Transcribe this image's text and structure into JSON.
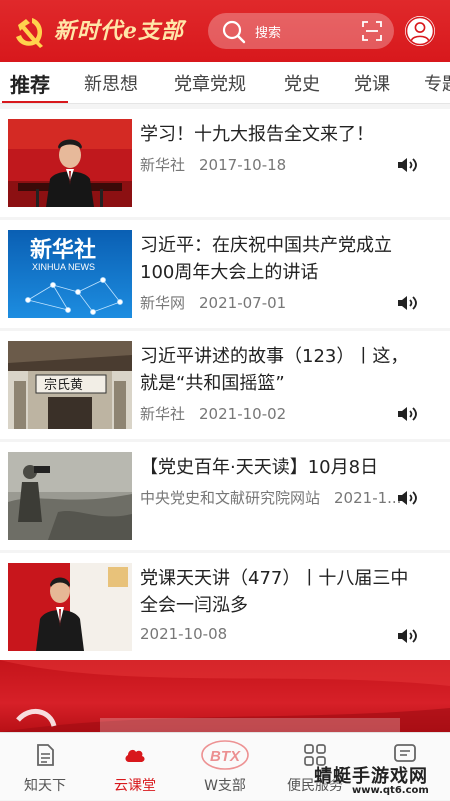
{
  "header": {
    "app_title": "新时代e支部",
    "search_placeholder": "搜索",
    "colors": {
      "primary": "#d8181c",
      "title_gold": "#ffe6a8"
    }
  },
  "tabs": [
    {
      "label": "推荐",
      "active": true
    },
    {
      "label": "新思想"
    },
    {
      "label": "党章党规"
    },
    {
      "label": "党史"
    },
    {
      "label": "党课"
    },
    {
      "label": "专题"
    }
  ],
  "news": [
    {
      "title": "学习！十九大报告全文来了！",
      "source": "新华社",
      "date": "2017-10-18",
      "icon": "speaker-icon"
    },
    {
      "title": "习近平：在庆祝中国共产党成立100周年大会上的讲话",
      "source": "新华网",
      "date": "2021-07-01",
      "icon": "speaker-icon",
      "thumb_text_cn": "新华社",
      "thumb_text_en": "XINHUA NEWS"
    },
    {
      "title": "习近平讲述的故事（123）丨这，就是“共和国摇篮”",
      "source": "新华社",
      "date": "2021-10-02",
      "icon": "speaker-icon",
      "thumb_sign": "宗氏黄"
    },
    {
      "title": "【党史百年·天天读】10月8日",
      "source": "中央党史和文献研究院网站",
      "date": "2021-1...",
      "icon": "speaker-icon"
    },
    {
      "title": "党课天天讲（477）丨十八届三中全会一闫泓多",
      "source": "",
      "date": "2021-10-08",
      "icon": "speaker-icon"
    }
  ],
  "bottom_nav": [
    {
      "label": "知天下",
      "icon": "document-icon"
    },
    {
      "label": "云课堂",
      "icon": "cloud-icon",
      "active": true
    },
    {
      "label": "W支部",
      "icon": "btx-logo-icon",
      "logo_text": "BTX"
    },
    {
      "label": "便民服务",
      "icon": "grid-icon"
    },
    {
      "label": "",
      "icon": "message-icon"
    }
  ],
  "watermark": {
    "main": "蜻蜓手游戏网",
    "url": "www.qt6.com"
  }
}
